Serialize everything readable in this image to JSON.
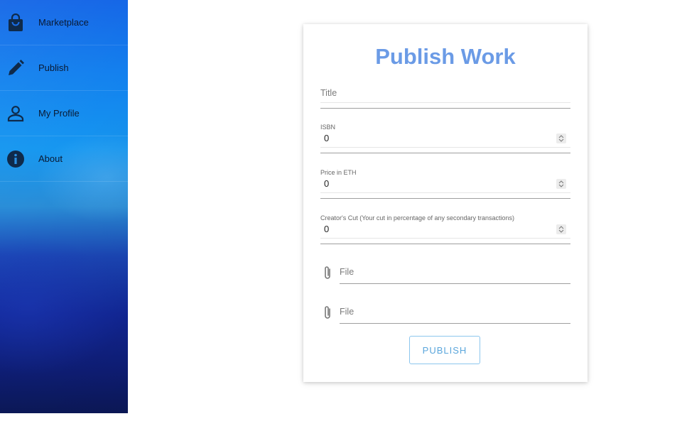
{
  "sidebar": {
    "items": [
      {
        "label": "Marketplace",
        "icon": "shopping-bag-icon"
      },
      {
        "label": "Publish",
        "icon": "pencil-icon"
      },
      {
        "label": "My Profile",
        "icon": "person-icon"
      },
      {
        "label": "About",
        "icon": "info-icon"
      }
    ]
  },
  "form": {
    "title": "Publish Work",
    "title_placeholder": "Title",
    "isbn_label": "ISBN",
    "isbn_value": "0",
    "price_label": "Price in ETH",
    "price_value": "0",
    "cut_label": "Creator's Cut (Your cut in percentage of any secondary transactions)",
    "cut_value": "0",
    "file1_label": "File",
    "file2_label": "File",
    "publish_label": "PUBLISH"
  },
  "colors": {
    "title": "#6b9be6",
    "button_text": "#5aa6dc",
    "button_border": "#8cc6ee",
    "sidebar_top": "#1063e6",
    "sidebar_bottom": "#0c1a5a"
  }
}
